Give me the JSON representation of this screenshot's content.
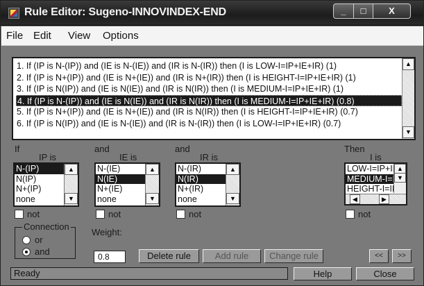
{
  "window": {
    "title": "Rule Editor: Sugeno-INNOVINDEX-END",
    "minimize": "_",
    "maximize": "□",
    "close": "X"
  },
  "menu": [
    "File",
    "Edit",
    "View",
    "Options"
  ],
  "rules": [
    "1. If (IP is N-(IP)) and (IE is N-(IE)) and (IR is N-(IR)) then (I is LOW-I=IP+IE+IR) (1)",
    "2. If (IP is N+(IP)) and (IE is N+(IE)) and (IR is N+(IR)) then (I is HEIGHT-I=IP+IE+IR) (1)",
    "3. If (IP is N(IP)) and (IE is N(IE)) and (IR is N(IR)) then (I is MEDIUM-I=IP+IE+IR) (1)",
    "4. If (IP is N-(IP)) and (IE is N(IE)) and (IR is N(IR)) then (I is MEDIUM-I=IP+IE+IR) (0.8)",
    "5. If (IP is N+(IP)) and (IE is N+(IE)) and (IR is N(IR)) then (I is HEIGHT-I=IP+IE+IR) (0.7)",
    "6. If (IP is N(IP)) and (IE is N-(IE)) and (IR is N-(IR)) then (I is LOW-I=IP+IE+IR) (0.7)"
  ],
  "selected_rule_index": 3,
  "antecedents": [
    {
      "prefix": "If",
      "label": "IP is",
      "options": [
        "N-(IP)",
        "N(IP)",
        "N+(IP)",
        "none"
      ],
      "selected": "N-(IP)",
      "not_label": "not"
    },
    {
      "prefix": "and",
      "label": "IE is",
      "options": [
        "N-(IE)",
        "N(IE)",
        "N+(IE)",
        "none"
      ],
      "selected": "N(IE)",
      "not_label": "not"
    },
    {
      "prefix": "and",
      "label": "IR is",
      "options": [
        "N-(IR)",
        "N(IR)",
        "N+(IR)",
        "none"
      ],
      "selected": "N(IR)",
      "not_label": "not"
    }
  ],
  "consequent": {
    "prefix": "Then",
    "label": "I is",
    "options": [
      "LOW-I=IP+IE",
      "MEDIUM-I=IP+IE",
      "HEIGHT-I=IP+IE"
    ],
    "selected": "MEDIUM-I=IP+IE",
    "not_label": "not"
  },
  "connection": {
    "title": "Connection",
    "options": [
      "or",
      "and"
    ],
    "selected": "and"
  },
  "weight": {
    "label": "Weight:",
    "value": "0.8"
  },
  "buttons": {
    "delete_rule": "Delete rule",
    "add_rule": "Add rule",
    "change_rule": "Change rule",
    "prev": "<<",
    "next": ">>"
  },
  "status": "Ready",
  "help": "Help",
  "close": "Close"
}
